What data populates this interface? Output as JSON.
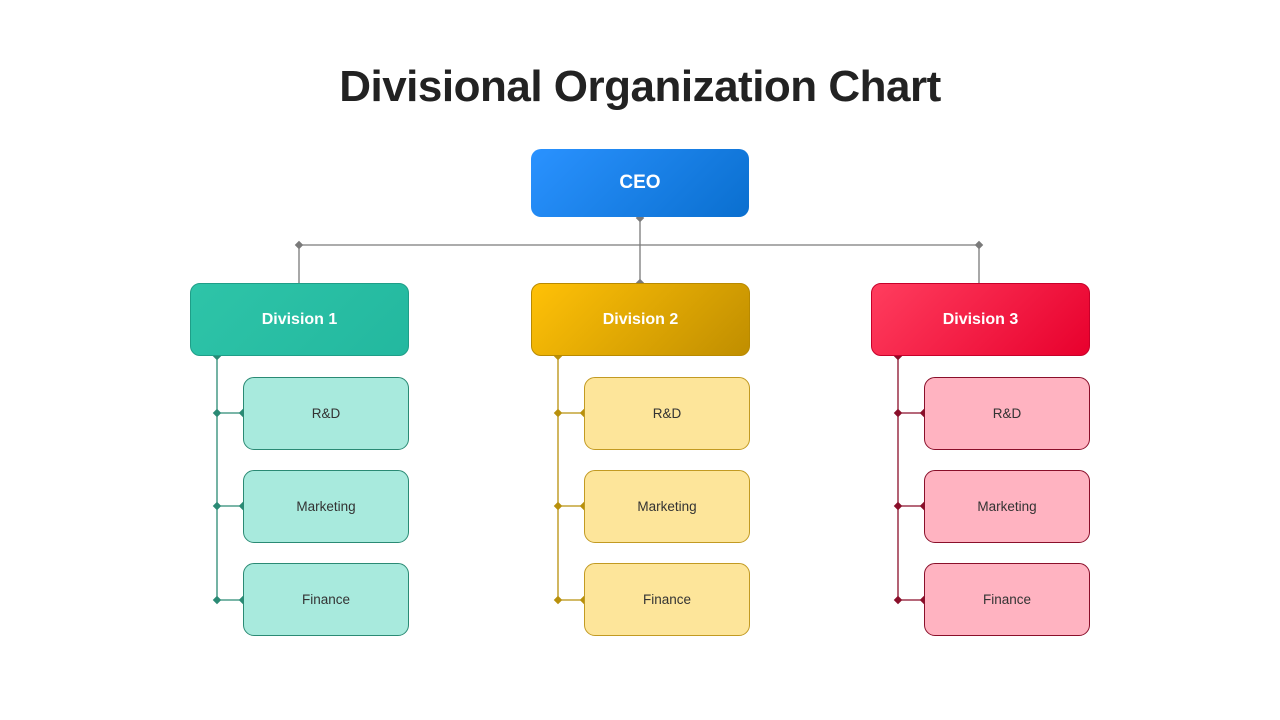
{
  "title": "Divisional Organization Chart",
  "ceo": {
    "label": "CEO",
    "color": "#1e86ee"
  },
  "connector_color": "#7a7a7a",
  "divisions": [
    {
      "label": "Division 1",
      "gradient": [
        "#2ec4a8",
        "#23b89f"
      ],
      "border": "#1f9e88",
      "line": "#2a8a74",
      "sub_fill": "#a8eadd",
      "sub_border": "#2a8a74",
      "units": [
        "R&D",
        "Marketing",
        "Finance"
      ]
    },
    {
      "label": "Division 2",
      "gradient": [
        "#ffc107",
        "#c08e00"
      ],
      "border": "#b98a00",
      "line": "#b8900c",
      "sub_fill": "#fde59a",
      "sub_border": "#c29a22",
      "units": [
        "R&D",
        "Marketing",
        "Finance"
      ]
    },
    {
      "label": "Division 3",
      "gradient": [
        "#ff3d5e",
        "#e8002d"
      ],
      "border": "#c7002a",
      "line": "#8a0f2a",
      "sub_fill": "#ffb3c1",
      "sub_border": "#8a0f2a",
      "units": [
        "R&D",
        "Marketing",
        "Finance"
      ]
    }
  ]
}
